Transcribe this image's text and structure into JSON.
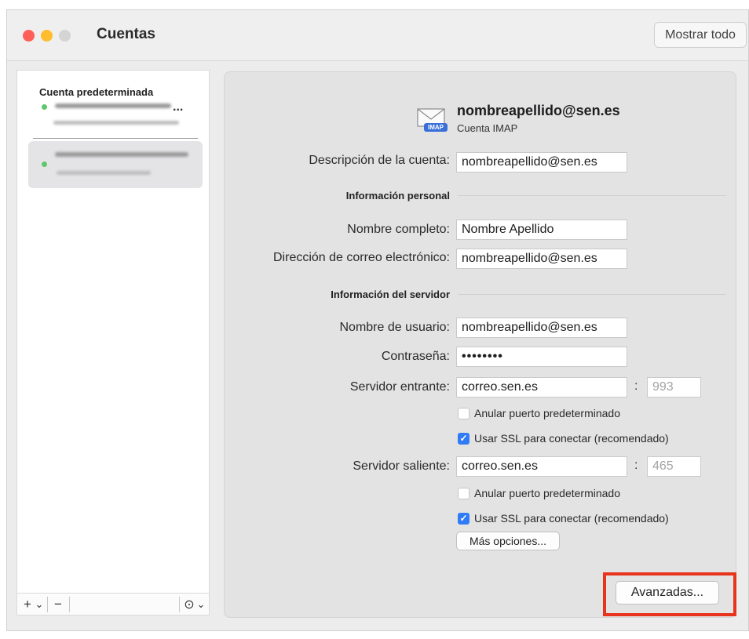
{
  "window": {
    "title": "Cuentas",
    "show_all_label": "Mostrar todo"
  },
  "sidebar": {
    "header": "Cuenta predeterminada",
    "ellipsis": "...",
    "toolbar": {
      "add": "+",
      "add_menu": "⌄",
      "remove": "−",
      "action": "⊙",
      "action_menu": "⌄"
    }
  },
  "account": {
    "email": "nombreapellido@sen.es",
    "type": "Cuenta IMAP",
    "icon_badge": "IMAP"
  },
  "form": {
    "description_label": "Descripción de la cuenta:",
    "description_value": "nombreapellido@sen.es",
    "personal_section": "Información personal",
    "full_name_label": "Nombre completo:",
    "full_name_value": "Nombre Apellido",
    "email_label": "Dirección de correo electrónico:",
    "email_value": "nombreapellido@sen.es",
    "server_section": "Información del servidor",
    "username_label": "Nombre de usuario:",
    "username_value": "nombreapellido@sen.es",
    "password_label": "Contraseña:",
    "password_value": "••••••••",
    "incoming_label": "Servidor entrante:",
    "incoming_value": "correo.sen.es",
    "incoming_port": "993",
    "incoming_override_label": "Anular puerto predeterminado",
    "incoming_ssl_label": "Usar SSL para conectar (recomendado)",
    "outgoing_label": "Servidor saliente:",
    "outgoing_value": "correo.sen.es",
    "outgoing_port": "465",
    "outgoing_override_label": "Anular puerto predeterminado",
    "outgoing_ssl_label": "Usar SSL para conectar (recomendado)",
    "more_options_label": "Más opciones...",
    "advanced_label": "Avanzadas...",
    "colon": ":",
    "check": "✓"
  },
  "colors": {
    "highlight": "#e8341c",
    "checkbox": "#2f7cf6",
    "status_dot": "#5ec76b"
  }
}
